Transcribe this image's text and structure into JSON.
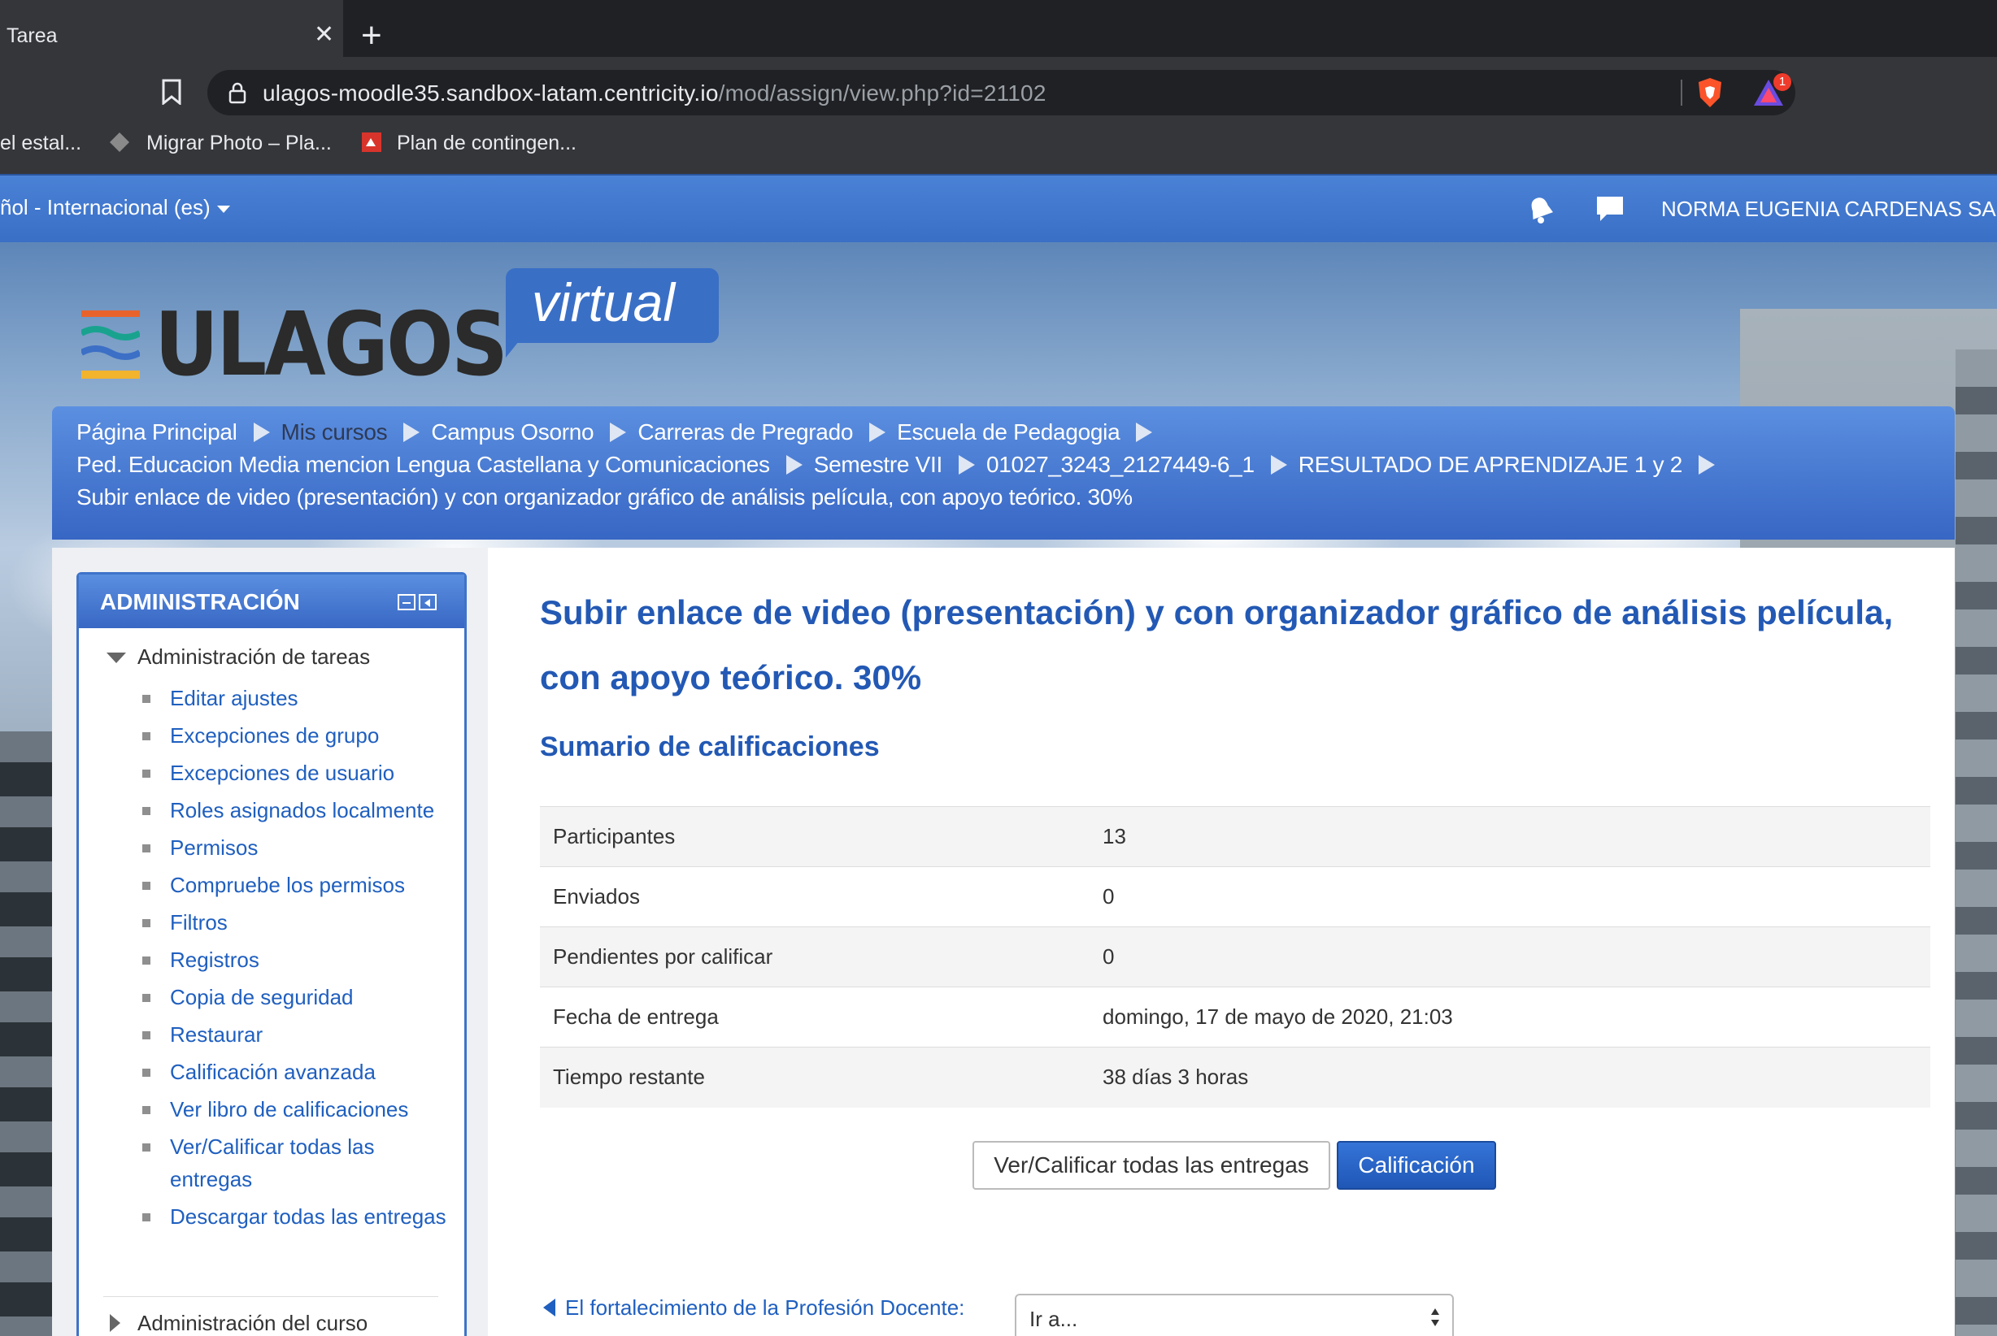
{
  "browser": {
    "tab_title": "Tarea",
    "tab_close": "✕",
    "new_tab": "+",
    "url_host": "ulagos-moodle35.sandbox-latam.centricity.io",
    "url_path": "/mod/assign/view.php?id=21102",
    "rewards_badge": "1",
    "bookmarks": [
      "el estal...",
      "Migrar Photo – Pla...",
      "Plan de contingen..."
    ]
  },
  "navbar": {
    "language": "ñol - Internacional (es)",
    "user_name": "NORMA EUGENIA CARDENAS SALD"
  },
  "logo": {
    "wordmark": "ULAGOS",
    "tagline": "virtual",
    "bar_colors": [
      "#e8632b",
      "#19a38f",
      "#3c6fc6",
      "#f2b32d"
    ]
  },
  "breadcrumb": {
    "items": [
      "Página Principal",
      "Mis cursos",
      "Campus Osorno",
      "Carreras de Pregrado",
      "Escuela de Pedagogia",
      "Ped. Educacion Media mencion Lengua Castellana y Comunicaciones",
      "Semestre VII",
      "01027_3243_2127449-6_1",
      "RESULTADO DE APRENDIZAJE 1 y 2",
      "Subir enlace de video (presentación) y con organizador gráfico de análisis película, con apoyo teórico. 30%"
    ]
  },
  "admin_block": {
    "title": "ADMINISTRACIÓN",
    "section_expanded": "Administración de tareas",
    "items": [
      "Editar ajustes",
      "Excepciones de grupo",
      "Excepciones de usuario",
      "Roles asignados localmente",
      "Permisos",
      "Compruebe los permisos",
      "Filtros",
      "Registros",
      "Copia de seguridad",
      "Restaurar",
      "Calificación avanzada",
      "Ver libro de calificaciones",
      "Ver/Calificar todas las entregas",
      "Descargar todas las entregas"
    ],
    "section_collapsed": "Administración del curso"
  },
  "main": {
    "title": "Subir enlace de video (presentación) y con organizador gráfico de análisis película, con apoyo teórico. 30%",
    "summary_title": "Sumario de calificaciones",
    "rows": [
      {
        "label": "Participantes",
        "value": "13"
      },
      {
        "label": "Enviados",
        "value": "0"
      },
      {
        "label": "Pendientes por calificar",
        "value": "0"
      },
      {
        "label": "Fecha de entrega",
        "value": "domingo, 17 de mayo de 2020, 21:03"
      },
      {
        "label": "Tiempo restante",
        "value": "38 días 3 horas"
      }
    ],
    "view_all_button": "Ver/Calificar todas las entregas",
    "grade_button": "Calificación",
    "prev_activity": "El fortalecimiento de la Profesión Docente:",
    "jump_select": "Ir a..."
  },
  "colors": {
    "moodle_blue": "#3a6fc6",
    "link": "#1f5fbf",
    "heading": "#2359b4"
  }
}
